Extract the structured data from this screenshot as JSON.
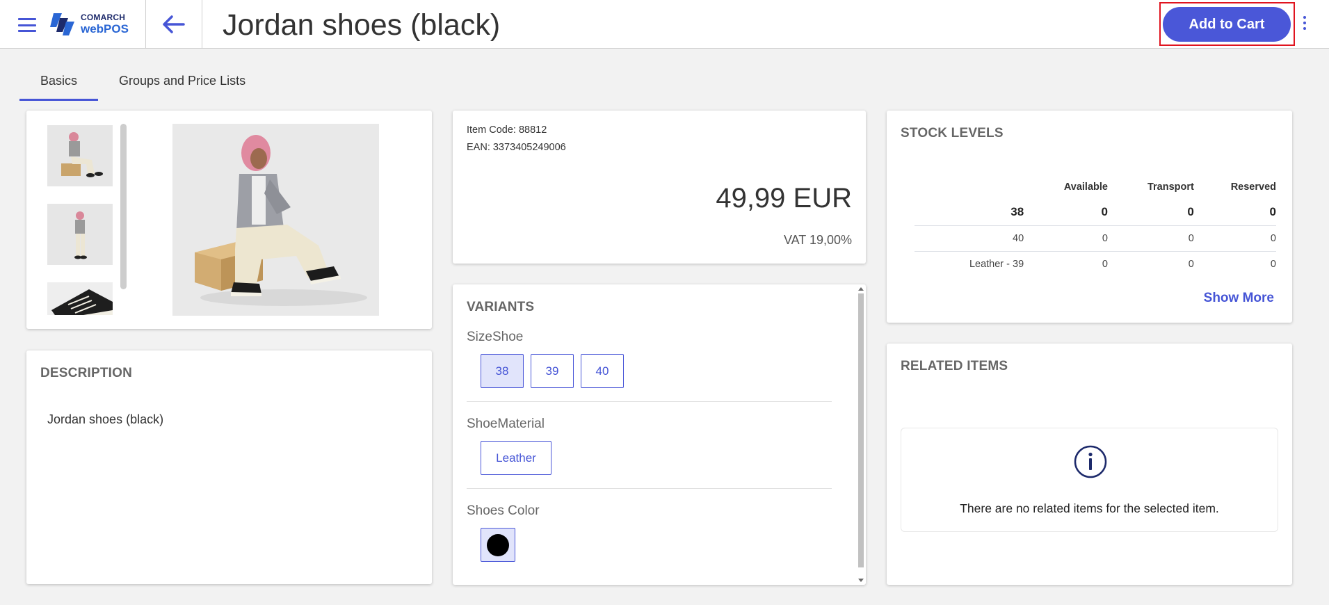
{
  "header": {
    "logo_top": "COMARCH",
    "logo_bottom": "webPOS",
    "title": "Jordan shoes (black)",
    "add_to_cart_label": "Add to Cart",
    "accent_color": "#4a57d8"
  },
  "tabs": [
    {
      "label": "Basics",
      "active": true
    },
    {
      "label": "Groups and Price Lists",
      "active": false
    }
  ],
  "images": {
    "thumbnails": [
      "model-sitting-thumbnail",
      "model-standing-thumbnail",
      "sneaker-closeup-thumbnail"
    ],
    "main_image": "model-sitting-on-box"
  },
  "price_card": {
    "item_code_line": "Item Code: 88812",
    "ean_line": "EAN: 3373405249006",
    "price": "49,99 EUR",
    "vat": "VAT 19,00%"
  },
  "stock": {
    "title": "STOCK LEVELS",
    "headers": [
      "Available",
      "Transport",
      "Reserved"
    ],
    "rows": [
      {
        "label": "38",
        "available": "0",
        "transport": "0",
        "reserved": "0"
      },
      {
        "label": "40",
        "available": "0",
        "transport": "0",
        "reserved": "0"
      },
      {
        "label": "Leather - 39",
        "available": "0",
        "transport": "0",
        "reserved": "0"
      }
    ],
    "show_more": "Show More"
  },
  "description": {
    "title": "DESCRIPTION",
    "text": "Jordan shoes (black)"
  },
  "variants": {
    "title": "VARIANTS",
    "size_label": "SizeShoe",
    "sizes": [
      "38",
      "39",
      "40"
    ],
    "selected_size": "38",
    "material_label": "ShoeMaterial",
    "materials": [
      "Leather"
    ],
    "color_label": "Shoes Color",
    "selected_color": "#000000"
  },
  "related": {
    "title": "RELATED ITEMS",
    "empty_message": "There are no related items for the selected item."
  }
}
